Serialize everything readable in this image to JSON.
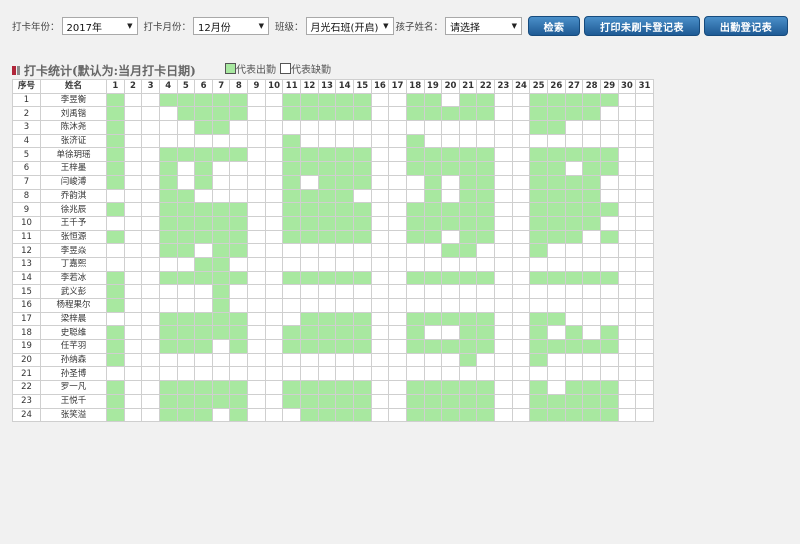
{
  "filters": {
    "year_label": "打卡年份：",
    "year_value": "2017年",
    "month_label": "打卡月份：",
    "month_value": "12月份",
    "class_label": "班级：",
    "class_value": "月光石班(开启)",
    "child_label": "孩子姓名：",
    "child_value": "请选择"
  },
  "buttons": {
    "search": "检索",
    "print_unswiped": "打印未刷卡登记表",
    "attendance_register": "出勤登记表"
  },
  "section_title": "打卡统计(默认为:当月打卡日期)",
  "legend": {
    "present": "代表出勤",
    "absent": "代表缺勤"
  },
  "colors": {
    "present": "#a8e8a0",
    "button": "#2a6aa6",
    "title_mark": "#b0263a"
  },
  "table": {
    "headers": {
      "index": "序号",
      "name": "姓名"
    },
    "days": [
      "1",
      "2",
      "3",
      "4",
      "5",
      "6",
      "7",
      "8",
      "9",
      "10",
      "11",
      "12",
      "13",
      "14",
      "15",
      "16",
      "17",
      "18",
      "19",
      "20",
      "21",
      "22",
      "23",
      "24",
      "25",
      "26",
      "27",
      "28",
      "29",
      "30",
      "31"
    ],
    "rows": [
      {
        "no": "1",
        "name": "李昱衡",
        "days": [
          1,
          0,
          0,
          1,
          1,
          1,
          1,
          1,
          0,
          0,
          1,
          1,
          1,
          1,
          1,
          0,
          0,
          1,
          1,
          0,
          1,
          1,
          0,
          0,
          1,
          1,
          1,
          1,
          1,
          0,
          0
        ]
      },
      {
        "no": "2",
        "name": "刘禹锴",
        "days": [
          1,
          0,
          0,
          0,
          1,
          1,
          1,
          1,
          0,
          0,
          1,
          1,
          1,
          1,
          1,
          0,
          0,
          1,
          1,
          1,
          1,
          1,
          0,
          0,
          1,
          1,
          1,
          1,
          0,
          0,
          0
        ]
      },
      {
        "no": "3",
        "name": "陈沐尧",
        "days": [
          1,
          0,
          0,
          0,
          0,
          1,
          1,
          0,
          0,
          0,
          0,
          0,
          0,
          0,
          0,
          0,
          0,
          0,
          0,
          0,
          0,
          0,
          0,
          0,
          1,
          1,
          0,
          0,
          0,
          0,
          0
        ]
      },
      {
        "no": "4",
        "name": "张济证",
        "days": [
          1,
          0,
          0,
          0,
          0,
          0,
          0,
          0,
          0,
          0,
          1,
          0,
          0,
          0,
          0,
          0,
          0,
          1,
          0,
          0,
          0,
          0,
          0,
          0,
          0,
          0,
          0,
          0,
          0,
          0,
          0
        ]
      },
      {
        "no": "5",
        "name": "单徐玥瑶",
        "days": [
          1,
          0,
          0,
          1,
          1,
          1,
          1,
          1,
          0,
          0,
          1,
          1,
          1,
          1,
          1,
          0,
          0,
          1,
          1,
          1,
          1,
          1,
          0,
          0,
          1,
          1,
          1,
          1,
          1,
          0,
          0
        ]
      },
      {
        "no": "6",
        "name": "王梓墨",
        "days": [
          1,
          0,
          0,
          1,
          0,
          1,
          0,
          0,
          0,
          0,
          1,
          1,
          1,
          1,
          1,
          0,
          0,
          1,
          1,
          1,
          1,
          1,
          0,
          0,
          1,
          1,
          0,
          1,
          1,
          0,
          0
        ]
      },
      {
        "no": "7",
        "name": "闫峻溥",
        "days": [
          1,
          0,
          0,
          1,
          0,
          1,
          0,
          0,
          0,
          0,
          1,
          0,
          1,
          1,
          1,
          0,
          0,
          0,
          1,
          0,
          1,
          1,
          0,
          0,
          1,
          1,
          1,
          1,
          0,
          0,
          0
        ]
      },
      {
        "no": "8",
        "name": "乔韵淇",
        "days": [
          0,
          0,
          0,
          1,
          1,
          0,
          0,
          0,
          0,
          0,
          1,
          1,
          1,
          1,
          0,
          0,
          0,
          0,
          1,
          0,
          1,
          1,
          0,
          0,
          1,
          1,
          1,
          1,
          0,
          0,
          0
        ]
      },
      {
        "no": "9",
        "name": "徐兆辰",
        "days": [
          1,
          0,
          0,
          1,
          1,
          1,
          1,
          1,
          0,
          0,
          1,
          1,
          1,
          1,
          1,
          0,
          0,
          1,
          1,
          1,
          1,
          1,
          0,
          0,
          1,
          1,
          1,
          1,
          1,
          0,
          0
        ]
      },
      {
        "no": "10",
        "name": "王千予",
        "days": [
          0,
          0,
          0,
          1,
          1,
          1,
          1,
          1,
          0,
          0,
          1,
          1,
          1,
          1,
          1,
          0,
          0,
          1,
          1,
          1,
          1,
          1,
          0,
          0,
          1,
          1,
          1,
          1,
          0,
          0,
          0
        ]
      },
      {
        "no": "11",
        "name": "张恒源",
        "days": [
          1,
          0,
          0,
          1,
          1,
          1,
          1,
          1,
          0,
          0,
          1,
          1,
          1,
          1,
          1,
          0,
          0,
          1,
          1,
          0,
          1,
          1,
          0,
          0,
          1,
          1,
          1,
          0,
          1,
          0,
          0
        ]
      },
      {
        "no": "12",
        "name": "李昱焱",
        "days": [
          0,
          0,
          0,
          1,
          1,
          0,
          1,
          1,
          0,
          0,
          0,
          0,
          0,
          0,
          0,
          0,
          0,
          0,
          0,
          1,
          1,
          0,
          0,
          0,
          1,
          0,
          0,
          0,
          0,
          0,
          0
        ]
      },
      {
        "no": "13",
        "name": "丁嘉熙",
        "days": [
          0,
          0,
          0,
          0,
          0,
          1,
          1,
          0,
          0,
          0,
          0,
          0,
          0,
          0,
          0,
          0,
          0,
          0,
          0,
          0,
          0,
          0,
          0,
          0,
          0,
          0,
          0,
          0,
          0,
          0,
          0
        ]
      },
      {
        "no": "14",
        "name": "李若冰",
        "days": [
          1,
          0,
          0,
          1,
          1,
          1,
          1,
          1,
          0,
          0,
          1,
          1,
          1,
          1,
          1,
          0,
          0,
          1,
          1,
          1,
          1,
          1,
          0,
          0,
          1,
          1,
          1,
          1,
          1,
          0,
          0
        ]
      },
      {
        "no": "15",
        "name": "武义彭",
        "days": [
          1,
          0,
          0,
          0,
          0,
          0,
          1,
          0,
          0,
          0,
          0,
          0,
          0,
          0,
          0,
          0,
          0,
          0,
          0,
          0,
          0,
          0,
          0,
          0,
          0,
          0,
          0,
          0,
          0,
          0,
          0
        ]
      },
      {
        "no": "16",
        "name": "杨程果尔",
        "days": [
          1,
          0,
          0,
          0,
          0,
          0,
          1,
          0,
          0,
          0,
          0,
          0,
          0,
          0,
          0,
          0,
          0,
          0,
          0,
          0,
          0,
          0,
          0,
          0,
          0,
          0,
          0,
          0,
          0,
          0,
          0
        ]
      },
      {
        "no": "17",
        "name": "梁梓晨",
        "days": [
          0,
          0,
          0,
          1,
          1,
          1,
          1,
          1,
          0,
          0,
          0,
          1,
          1,
          1,
          1,
          0,
          0,
          1,
          1,
          1,
          1,
          1,
          0,
          0,
          1,
          1,
          0,
          0,
          0,
          0,
          0
        ]
      },
      {
        "no": "18",
        "name": "史聪维",
        "days": [
          1,
          0,
          0,
          1,
          1,
          1,
          1,
          1,
          0,
          0,
          1,
          1,
          1,
          1,
          1,
          0,
          0,
          1,
          0,
          0,
          1,
          1,
          0,
          0,
          1,
          0,
          1,
          0,
          1,
          0,
          0
        ]
      },
      {
        "no": "19",
        "name": "任芊羽",
        "days": [
          1,
          0,
          0,
          1,
          1,
          1,
          0,
          1,
          0,
          0,
          1,
          1,
          1,
          1,
          1,
          0,
          0,
          1,
          1,
          1,
          1,
          1,
          0,
          0,
          1,
          1,
          1,
          1,
          1,
          0,
          0
        ]
      },
      {
        "no": "20",
        "name": "孙纳森",
        "days": [
          1,
          0,
          0,
          0,
          0,
          0,
          0,
          0,
          0,
          0,
          0,
          0,
          0,
          0,
          0,
          0,
          0,
          0,
          0,
          0,
          1,
          0,
          0,
          0,
          1,
          0,
          0,
          0,
          0,
          0,
          0
        ]
      },
      {
        "no": "21",
        "name": "孙圣博",
        "days": [
          0,
          0,
          0,
          0,
          0,
          0,
          0,
          0,
          0,
          0,
          0,
          0,
          0,
          0,
          0,
          0,
          0,
          0,
          0,
          0,
          0,
          0,
          0,
          0,
          0,
          0,
          0,
          0,
          0,
          0,
          0
        ]
      },
      {
        "no": "22",
        "name": "罗一凡",
        "days": [
          1,
          0,
          0,
          1,
          1,
          1,
          1,
          1,
          0,
          0,
          1,
          1,
          1,
          1,
          1,
          0,
          0,
          1,
          1,
          1,
          1,
          1,
          0,
          0,
          1,
          0,
          1,
          1,
          1,
          0,
          0
        ]
      },
      {
        "no": "23",
        "name": "王悦千",
        "days": [
          1,
          0,
          0,
          1,
          1,
          1,
          1,
          1,
          0,
          0,
          1,
          1,
          1,
          1,
          1,
          0,
          0,
          1,
          1,
          1,
          1,
          1,
          0,
          0,
          1,
          1,
          1,
          1,
          1,
          0,
          0
        ]
      },
      {
        "no": "24",
        "name": "张笑溢",
        "days": [
          1,
          0,
          0,
          1,
          1,
          1,
          0,
          1,
          0,
          0,
          0,
          1,
          1,
          1,
          1,
          0,
          0,
          1,
          1,
          1,
          1,
          1,
          0,
          0,
          1,
          1,
          1,
          1,
          1,
          0,
          0
        ]
      }
    ]
  }
}
